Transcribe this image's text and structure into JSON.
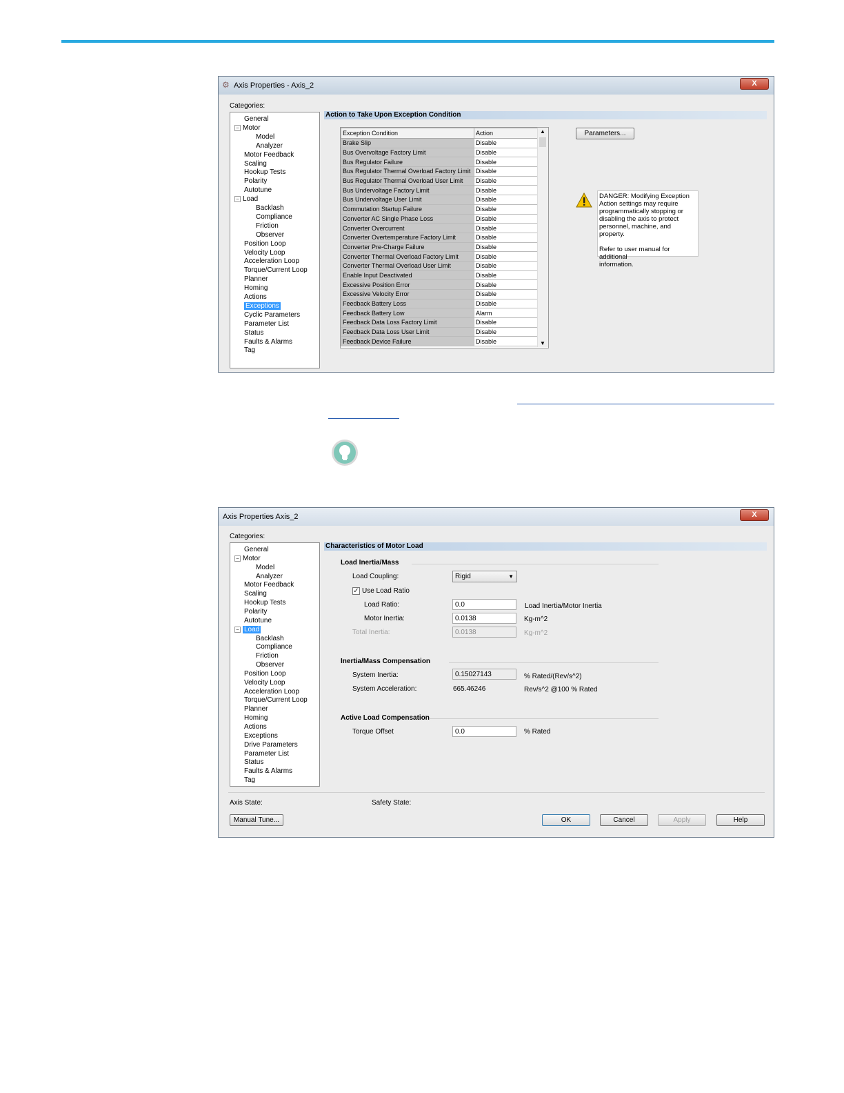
{
  "dialog1": {
    "title": "Axis Properties - Axis_2",
    "close": "X",
    "categories_label": "Categories:",
    "tree": [
      {
        "label": "General",
        "level": 0
      },
      {
        "label": "Motor",
        "level": 0,
        "toggle": "−"
      },
      {
        "label": "Model",
        "level": 1
      },
      {
        "label": "Analyzer",
        "level": 1
      },
      {
        "label": "Motor Feedback",
        "level": 0
      },
      {
        "label": "Scaling",
        "level": 0
      },
      {
        "label": "Hookup Tests",
        "level": 0
      },
      {
        "label": "Polarity",
        "level": 0
      },
      {
        "label": "Autotune",
        "level": 0
      },
      {
        "label": "Load",
        "level": 0,
        "toggle": "−"
      },
      {
        "label": "Backlash",
        "level": 1
      },
      {
        "label": "Compliance",
        "level": 1
      },
      {
        "label": "Friction",
        "level": 1
      },
      {
        "label": "Observer",
        "level": 1
      },
      {
        "label": "Position Loop",
        "level": 0
      },
      {
        "label": "Velocity Loop",
        "level": 0
      },
      {
        "label": "Acceleration Loop",
        "level": 0
      },
      {
        "label": "Torque/Current Loop",
        "level": 0
      },
      {
        "label": "Planner",
        "level": 0
      },
      {
        "label": "Homing",
        "level": 0
      },
      {
        "label": "Actions",
        "level": 0
      },
      {
        "label": "Exceptions",
        "level": 0,
        "selected": true
      },
      {
        "label": "Cyclic Parameters",
        "level": 0
      },
      {
        "label": "Parameter List",
        "level": 0
      },
      {
        "label": "Status",
        "level": 0
      },
      {
        "label": "Faults & Alarms",
        "level": 0
      },
      {
        "label": "Tag",
        "level": 0
      }
    ],
    "section_title": "Action to Take Upon Exception Condition",
    "parameters_button": "Parameters...",
    "columns": [
      "Exception Condition",
      "Action"
    ],
    "rows": [
      [
        "Brake Slip",
        "Disable"
      ],
      [
        "Bus Overvoltage Factory Limit",
        "Disable"
      ],
      [
        "Bus Regulator Failure",
        "Disable"
      ],
      [
        "Bus Regulator Thermal Overload Factory Limit",
        "Disable"
      ],
      [
        "Bus Regulator Thermal Overload User Limit",
        "Disable"
      ],
      [
        "Bus Undervoltage Factory Limit",
        "Disable"
      ],
      [
        "Bus Undervoltage User Limit",
        "Disable"
      ],
      [
        "Commutation Startup Failure",
        "Disable"
      ],
      [
        "Converter AC Single Phase Loss",
        "Disable"
      ],
      [
        "Converter Overcurrent",
        "Disable"
      ],
      [
        "Converter Overtemperature Factory Limit",
        "Disable"
      ],
      [
        "Converter Pre-Charge Failure",
        "Disable"
      ],
      [
        "Converter Thermal Overload Factory Limit",
        "Disable"
      ],
      [
        "Converter Thermal Overload User Limit",
        "Disable"
      ],
      [
        "Enable Input Deactivated",
        "Disable"
      ],
      [
        "Excessive Position Error",
        "Disable"
      ],
      [
        "Excessive Velocity Error",
        "Disable"
      ],
      [
        "Feedback Battery Loss",
        "Disable"
      ],
      [
        "Feedback Battery Low",
        "Alarm"
      ],
      [
        "Feedback Data Loss Factory Limit",
        "Disable"
      ],
      [
        "Feedback Data Loss User Limit",
        "Disable"
      ],
      [
        "Feedback Device Failure",
        "Disable"
      ]
    ],
    "danger_lines": [
      "DANGER: Modifying Exception",
      "Action settings may require",
      "programmatically stopping or",
      "disabling the axis to protect",
      "personnel, machine, and property.",
      "",
      "Refer to user manual for additional",
      "information."
    ]
  },
  "dialog2": {
    "title": "Axis Properties  Axis_2",
    "close": "X",
    "categories_label": "Categories:",
    "tree": [
      {
        "label": "General",
        "level": 0
      },
      {
        "label": "Motor",
        "level": 0,
        "toggle": "−"
      },
      {
        "label": "Model",
        "level": 1
      },
      {
        "label": "Analyzer",
        "level": 1
      },
      {
        "label": "Motor Feedback",
        "level": 0
      },
      {
        "label": "Scaling",
        "level": 0
      },
      {
        "label": "Hookup Tests",
        "level": 0
      },
      {
        "label": "Polarity",
        "level": 0
      },
      {
        "label": "Autotune",
        "level": 0
      },
      {
        "label": "Load",
        "level": 0,
        "toggle": "−",
        "selected": true
      },
      {
        "label": "Backlash",
        "level": 1
      },
      {
        "label": "Compliance",
        "level": 1
      },
      {
        "label": "Friction",
        "level": 1
      },
      {
        "label": "Observer",
        "level": 1
      },
      {
        "label": "Position Loop",
        "level": 0
      },
      {
        "label": "Velocity Loop",
        "level": 0
      },
      {
        "label": "Acceleration Loop",
        "level": 0
      },
      {
        "label": "Torque/Current Loop",
        "level": 0
      },
      {
        "label": "Planner",
        "level": 0
      },
      {
        "label": "Homing",
        "level": 0
      },
      {
        "label": "Actions",
        "level": 0
      },
      {
        "label": "Exceptions",
        "level": 0
      },
      {
        "label": "Drive Parameters",
        "level": 0
      },
      {
        "label": "Parameter List",
        "level": 0
      },
      {
        "label": "Status",
        "level": 0
      },
      {
        "label": "Faults & Alarms",
        "level": 0
      },
      {
        "label": "Tag",
        "level": 0
      }
    ],
    "section_title": "Characteristics of Motor Load",
    "load_inertia": {
      "group": "Load Inertia/Mass",
      "coupling_label": "Load Coupling:",
      "coupling_value": "Rigid",
      "use_ratio_label": "Use Load Ratio",
      "use_ratio_checked": true,
      "load_ratio_label": "Load Ratio:",
      "load_ratio_value": "0.0",
      "load_ratio_unit": "Load Inertia/Motor Inertia",
      "motor_inertia_label": "Motor Inertia:",
      "motor_inertia_value": "0.0138",
      "motor_inertia_unit": "Kg-m^2",
      "total_inertia_label": "Total Inertia:",
      "total_inertia_value": "0.0138",
      "total_inertia_unit": "Kg-m^2"
    },
    "compensation": {
      "group": "Inertia/Mass Compensation",
      "system_inertia_label": "System Inertia:",
      "system_inertia_value": "0.15027143",
      "system_inertia_unit": "% Rated/(Rev/s^2)",
      "system_accel_label": "System Acceleration:",
      "system_accel_value": "665.46246",
      "system_accel_unit": "Rev/s^2 @100 % Rated"
    },
    "active_load": {
      "group": "Active Load Compensation",
      "torque_offset_label": "Torque Offset",
      "torque_offset_value": "0.0",
      "torque_offset_unit": "% Rated"
    },
    "axis_state_label": "Axis State:",
    "safety_state_label": "Safety State:",
    "buttons": {
      "manual_tune": "Manual Tune...",
      "ok": "OK",
      "cancel": "Cancel",
      "apply": "Apply",
      "help": "Help"
    }
  },
  "colors": {
    "accent_bar": "#29a9e0",
    "link": "#2a5db0",
    "selection": "#3399ff"
  },
  "icons": [
    "lightbulb-icon",
    "warning-icon",
    "gear-icon",
    "close-icon"
  ]
}
